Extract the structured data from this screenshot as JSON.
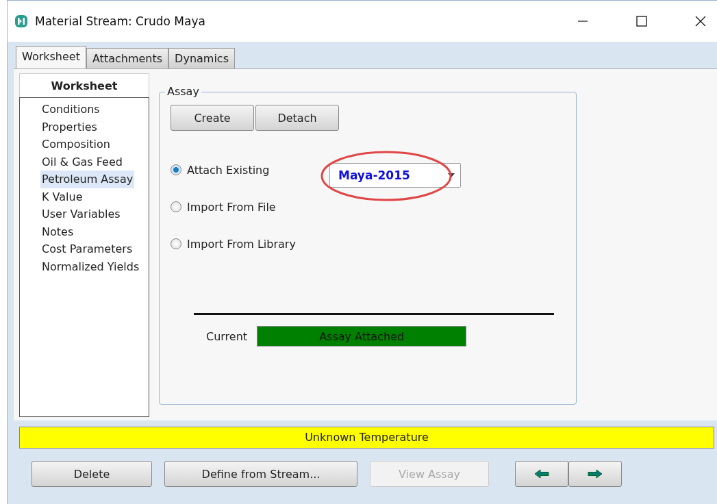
{
  "window": {
    "title": "Material Stream: Crudo Maya"
  },
  "tabs": [
    {
      "label": "Worksheet",
      "selected": true
    },
    {
      "label": "Attachments",
      "selected": false
    },
    {
      "label": "Dynamics",
      "selected": false
    }
  ],
  "sidebar": {
    "title": "Worksheet",
    "items": [
      {
        "label": "Conditions",
        "selected": false
      },
      {
        "label": "Properties",
        "selected": false
      },
      {
        "label": "Composition",
        "selected": false
      },
      {
        "label": "Oil & Gas Feed",
        "selected": false
      },
      {
        "label": "Petroleum Assay",
        "selected": true
      },
      {
        "label": "K Value",
        "selected": false
      },
      {
        "label": "User Variables",
        "selected": false
      },
      {
        "label": "Notes",
        "selected": false
      },
      {
        "label": "Cost Parameters",
        "selected": false
      },
      {
        "label": "Normalized Yields",
        "selected": false
      }
    ]
  },
  "assay": {
    "title": "Assay",
    "buttons": [
      "Create",
      "Detach"
    ],
    "options": [
      {
        "label": "Attach Existing",
        "selected": true
      },
      {
        "label": "Import From File",
        "selected": false
      },
      {
        "label": "Import From Library",
        "selected": false
      }
    ],
    "dropdown": {
      "value": "Maya-2015"
    },
    "current_label": "Current",
    "current_status": "Assay Attached"
  },
  "status_bar": "Unknown Temperature",
  "buttons": [
    {
      "label": "Delete",
      "disabled": false
    },
    {
      "label": "Define from Stream...",
      "disabled": false
    },
    {
      "label": "View Assay",
      "disabled": true
    }
  ]
}
